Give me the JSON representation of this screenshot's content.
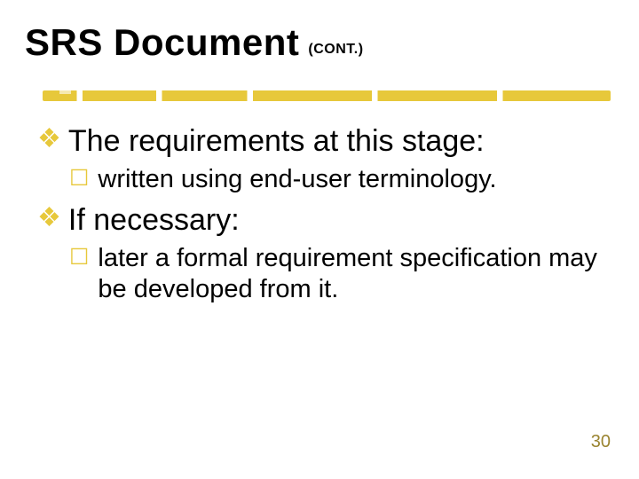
{
  "title": {
    "main": "SRS Document",
    "cont": "(CONT.)"
  },
  "bullets": {
    "b1": {
      "glyph": "❖",
      "text": "The requirements at this stage:"
    },
    "b1_1": {
      "glyph": "☐",
      "text": "written using  end-user terminology."
    },
    "b2": {
      "glyph": "❖",
      "text": "If necessary:"
    },
    "b2_1": {
      "glyph": "☐",
      "text": "later a formal requirement specification may be developed from it."
    }
  },
  "page_number": "30"
}
